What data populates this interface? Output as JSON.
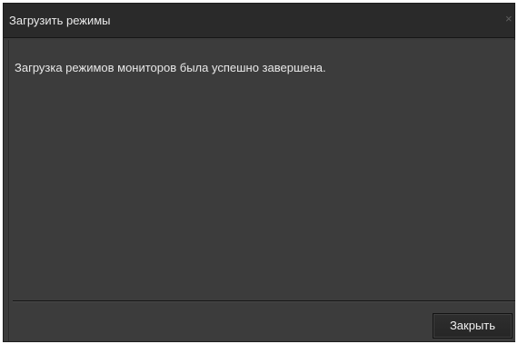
{
  "dialog": {
    "title": "Загрузить режимы",
    "close_icon": "close-icon",
    "close_glyph": "×",
    "message": "Загрузка режимов мониторов была успешно завершена.",
    "close_button_label": "Закрыть"
  }
}
